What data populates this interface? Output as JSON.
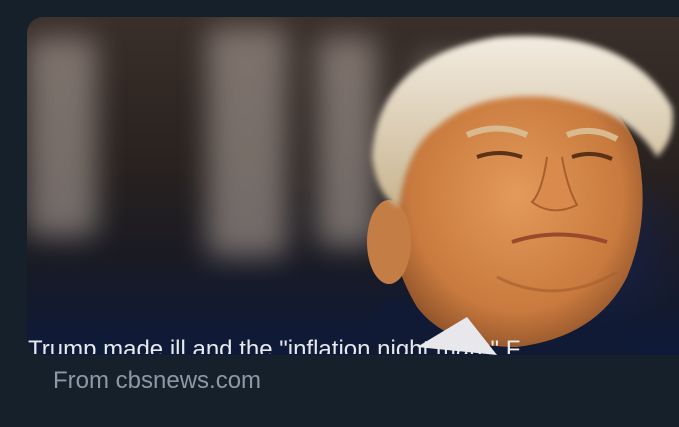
{
  "card": {
    "headline": "Trump made ill and the \"inflation night mare\" F",
    "source": "From cbsnews.com"
  }
}
